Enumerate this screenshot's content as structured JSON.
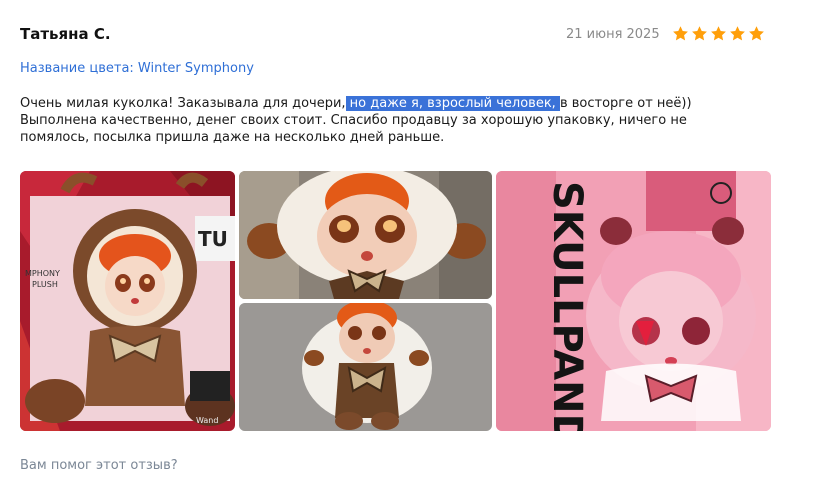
{
  "review": {
    "author": "Татьяна С.",
    "date": "21 июня 2025",
    "rating": 5,
    "color_label": "Название цвета: Winter Symphony",
    "text_before": "Очень милая куколка! Заказывала для дочери,",
    "text_highlight": " но даже я, взрослый человек, ",
    "text_after": "в восторге от неё)) Выполнена качественно, денег своих стоит. Спасибо продавцу за хорошую упаковку, ничего не помялось, посылка пришла даже на несколько дней раньше.",
    "star_color": "#ff9f0a"
  },
  "photos": [
    {
      "name": "photo-doll-box-front",
      "box_text_1": "MPHONY",
      "box_text_2": "PLUSH",
      "box_text_3": "TU",
      "box_text_4": "Wand"
    },
    {
      "name": "photo-doll-face-closeup"
    },
    {
      "name": "photo-doll-on-carpet"
    },
    {
      "name": "photo-skullpanda-box",
      "box_text": "SKULLPANDA"
    }
  ],
  "footer": {
    "helpful_question": "Вам помог этот отзыв?"
  }
}
